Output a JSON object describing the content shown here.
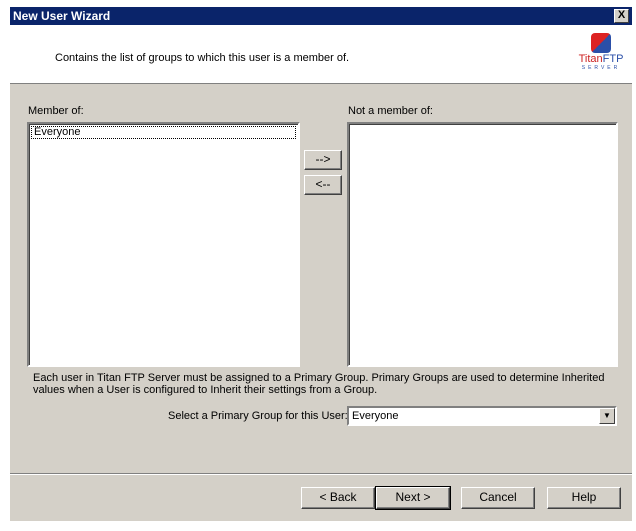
{
  "window": {
    "title": "New User Wizard",
    "close_label": "X"
  },
  "header": {
    "description": "Contains the list of groups to which this user is a member of.",
    "logo": {
      "brand_part1": "Titan",
      "brand_part2": "FTP",
      "tagline": "SERVER"
    }
  },
  "member_of": {
    "label": "Member of:",
    "items": [
      "Everyone"
    ]
  },
  "not_member_of": {
    "label": "Not a member of:",
    "items": []
  },
  "transfer": {
    "add_label": "-->",
    "remove_label": "<--"
  },
  "info_text": "Each user in Titan FTP Server must be assigned to a Primary Group. Primary Groups are used to determine Inherited values when a User is configured to Inherit their settings from a Group.",
  "primary_group": {
    "label": "Select a Primary Group for this User:",
    "value": "Everyone"
  },
  "buttons": {
    "back": "< Back",
    "next": "Next >",
    "cancel": "Cancel",
    "help": "Help"
  },
  "colors": {
    "titlebar": "#0a246a",
    "face": "#d4d0c8"
  }
}
